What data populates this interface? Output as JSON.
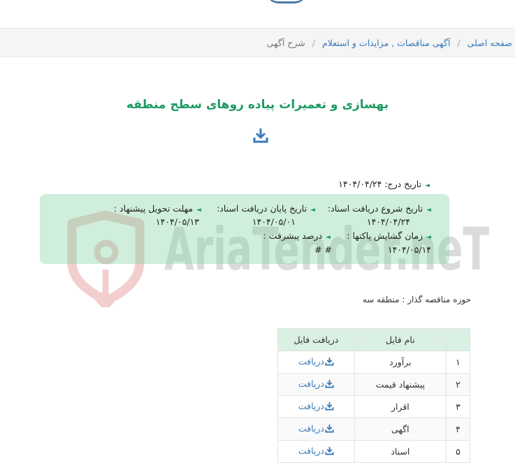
{
  "breadcrumb": {
    "home": "صفحه اصلی",
    "category": "آگهی مناقصات , مزایدات و استعلام",
    "current": "شرح آگهی",
    "separator": "/"
  },
  "title": "بهسازی و تعمیرات پیاده روهای سطح منطقه",
  "watermark": "AriaTender.neT",
  "registration": {
    "label": "تاریخ درج:",
    "value": "۱۴۰۴/۰۴/۲۴"
  },
  "info": {
    "doc_start": {
      "label": "تاریخ شروع دریافت اسناد:",
      "value": "۱۴۰۴/۰۴/۲۴"
    },
    "doc_end": {
      "label": "تاریخ پایان دریافت اسناد:",
      "value": "۱۴۰۴/۰۵/۰۱"
    },
    "deadline": {
      "label": "مهلت تحویل پیشنهاد :",
      "value": "۱۴۰۴/۰۵/۱۳"
    },
    "opening": {
      "label": "زمان گشایش پاکتها :",
      "value": "۱۴۰۴/۰۵/۱۴"
    },
    "progress": {
      "label": "درصد پیشرفت :",
      "value": "# #"
    }
  },
  "authority": "حوزه مناقصه گذار : منطقه سه",
  "files": {
    "headers": {
      "num": "",
      "name": "نام فایل",
      "download": "دریافت فایل"
    },
    "rows": [
      {
        "num": "۱",
        "name": "برآورد",
        "download": "دریافت"
      },
      {
        "num": "۲",
        "name": "پیشنهاد قیمت",
        "download": "دریافت"
      },
      {
        "num": "۳",
        "name": "اقرار",
        "download": "دریافت"
      },
      {
        "num": "۴",
        "name": "اگهی",
        "download": "دریافت"
      },
      {
        "num": "۵",
        "name": "اسناد",
        "download": "دریافت"
      }
    ]
  },
  "colors": {
    "accent": "#1e9b62",
    "link": "#3a7ab8",
    "box": "#c3ead2",
    "header_bg": "#d9f0e2"
  },
  "icons": {
    "download": "download-icon",
    "bullet": "triangle-left-icon"
  }
}
